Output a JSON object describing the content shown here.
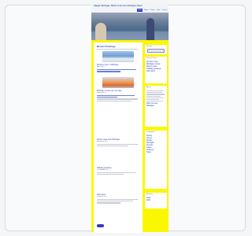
{
  "site": {
    "title": "Magia Michigan Mitch & Anna's Michigan Web",
    "nav": [
      "Home",
      "About",
      "Photos",
      "Links",
      "Contact"
    ],
    "nav_active_index": 0
  },
  "main": {
    "section_heading": "Recent Postings",
    "posts": [
      {
        "title": "Spring is here in Michigan",
        "meta": "April 2012",
        "has_image": true,
        "image": "lake-scene"
      },
      {
        "title": "Michigan sunset over the lake",
        "meta": "March 2012",
        "has_image": true,
        "image": "sunset"
      },
      {
        "title": "Winter notes from Michigan",
        "meta": "February 2012",
        "has_image": false
      },
      {
        "title": "Holiday greetings",
        "meta": "December 2011",
        "has_image": false
      },
      {
        "title": "Fall colors",
        "meta": "October 2011",
        "has_image": false
      }
    ],
    "more_button": ""
  },
  "sidebar": {
    "widgets": [
      {
        "heading": "Search",
        "has_input": true
      },
      {
        "heading": "Recent Posts",
        "items": [
          "Spring is here",
          "Michigan sunset",
          "Winter notes",
          "Holiday greetings",
          "Fall colors"
        ]
      },
      {
        "heading": "About",
        "items": [
          "Mitch & Anna",
          "Michigan"
        ]
      },
      {
        "heading": "Categories",
        "items": [
          "Family",
          "Travel",
          "Photos",
          "Michigan",
          "Friends",
          "Lakes",
          "Seasons",
          "News"
        ]
      },
      {
        "heading": "Archives",
        "items": [
          "2012",
          "2011"
        ]
      }
    ]
  },
  "colors": {
    "page_background": "#fbf700",
    "link": "#2740b7",
    "button": "#2f39c8"
  }
}
